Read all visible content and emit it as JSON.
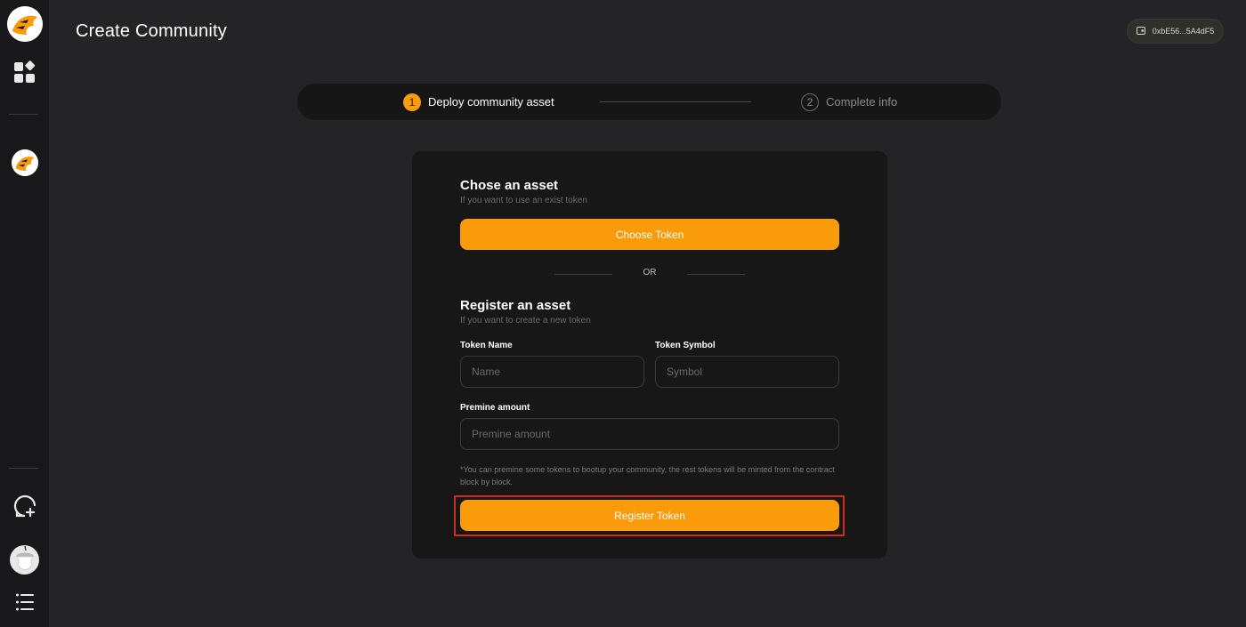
{
  "header": {
    "title": "Create Community",
    "wallet_address": "0xbE56...5A4dF5"
  },
  "sidebar": {
    "items": [
      {
        "name": "app-logo"
      },
      {
        "name": "apps-grid"
      },
      {
        "name": "community-avatar"
      },
      {
        "name": "create-community"
      },
      {
        "name": "user-avatar"
      },
      {
        "name": "menu"
      }
    ]
  },
  "stepper": {
    "steps": [
      {
        "number": "1",
        "label": "Deploy community asset",
        "active": true
      },
      {
        "number": "2",
        "label": "Complete info",
        "active": false
      }
    ]
  },
  "choose_section": {
    "title": "Chose an asset",
    "subtitle": "If you want to use an exist token",
    "button_label": "Choose Token"
  },
  "or_label": "OR",
  "register_section": {
    "title": "Register an asset",
    "subtitle": "If you want to create a new token",
    "token_name_label": "Token Name",
    "token_name_placeholder": "Name",
    "token_symbol_label": "Token Symbol",
    "token_symbol_placeholder": "Symbol",
    "premine_label": "Premine amount",
    "premine_placeholder": "Premine amount",
    "note": "*You can premine some tokens to bootup your community, the rest tokens will be minted from the contract block by block.",
    "button_label": "Register Token"
  },
  "colors": {
    "accent": "#fa9b0b",
    "background": "#242426",
    "sidebar": "#18181a",
    "highlight": "#d42a1e"
  }
}
